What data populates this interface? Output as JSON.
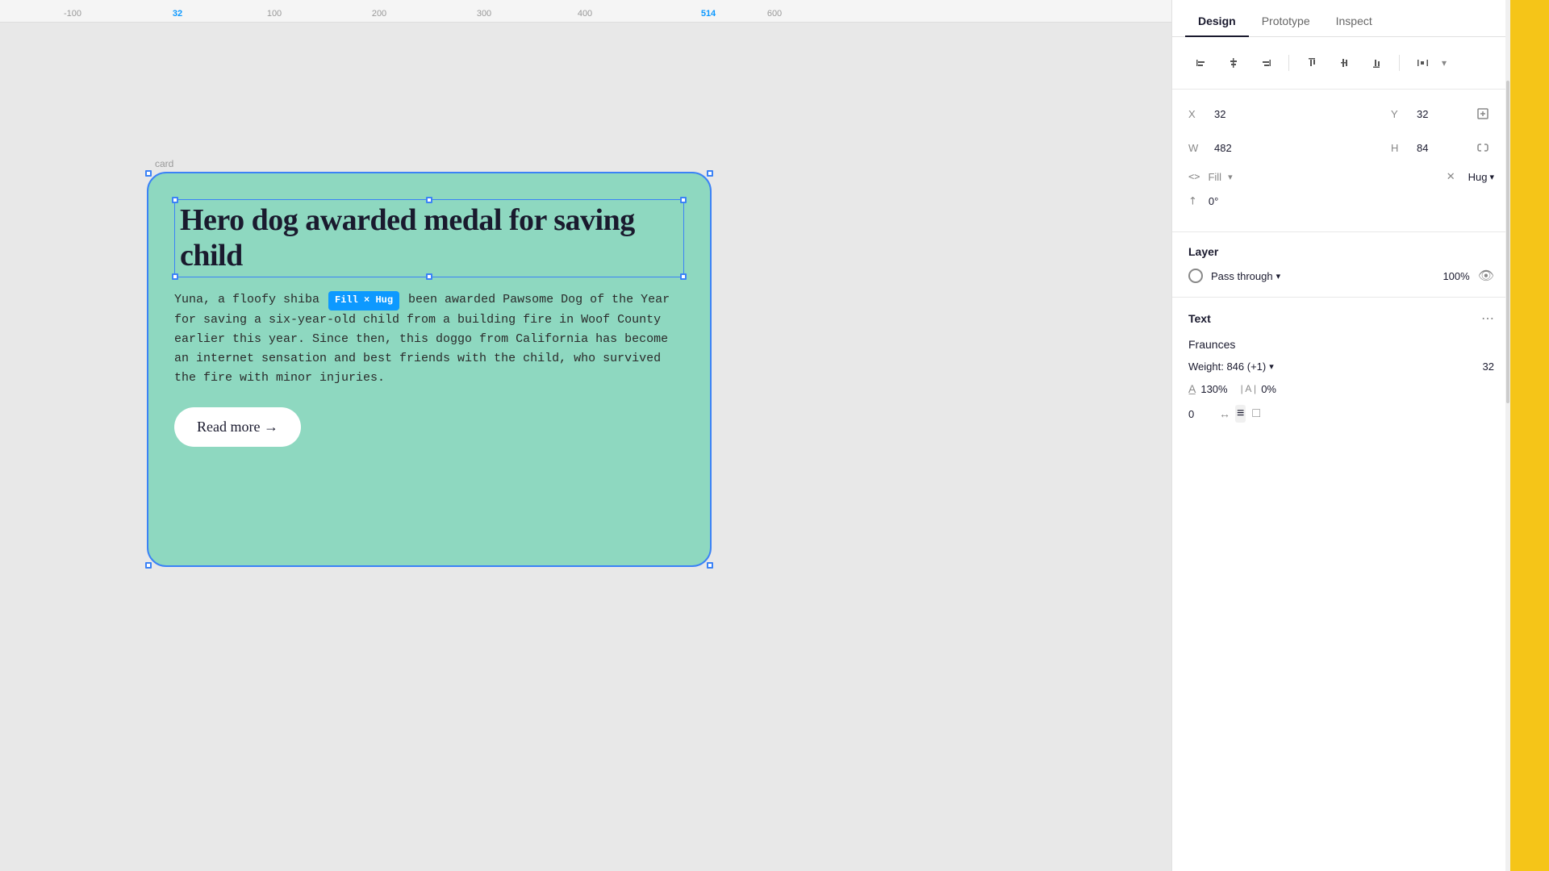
{
  "canvas": {
    "ruler": {
      "marks": [
        "-100",
        "32",
        "100",
        "200",
        "300",
        "400",
        "514",
        "600"
      ],
      "active": "32"
    },
    "card": {
      "label": "card",
      "title": "Hero dog awarded medal for saving child",
      "body_part1": "Yuna, a floofy shiba ",
      "badge": "Fill × Hug",
      "body_part2": " been awarded Pawsome Dog of the Year for saving a six-year-old child from a building fire in Woof County earlier this year. Since then, this doggo from California has become an internet sensation and best friends with the child, who survived the fire with minor injuries.",
      "read_more": "Read more →"
    }
  },
  "panel": {
    "tabs": [
      "Design",
      "Prototype",
      "Inspect"
    ],
    "active_tab": "Design",
    "align_buttons": [
      "align-left",
      "align-center-v",
      "align-right",
      "align-top",
      "align-center-h",
      "align-bottom",
      "distribute"
    ],
    "properties": {
      "x_label": "X",
      "x_value": "32",
      "y_label": "Y",
      "y_value": "32",
      "w_label": "W",
      "w_value": "482",
      "h_label": "H",
      "h_value": "84",
      "fill_label": "Fill",
      "hug_value": "Hug",
      "angle_value": "0°"
    },
    "layer": {
      "title": "Layer",
      "blend_mode": "Pass through",
      "opacity": "100%"
    },
    "text": {
      "title": "Text",
      "font_name": "Fraunces",
      "weight_label": "Weight: 846 (+1)",
      "font_size": "32",
      "line_height": "130%",
      "letter_spacing_label": "| A |",
      "letter_spacing": "0%",
      "paragraph_spacing": "0",
      "align_center_icon": "≡",
      "box_icon": "□"
    }
  }
}
